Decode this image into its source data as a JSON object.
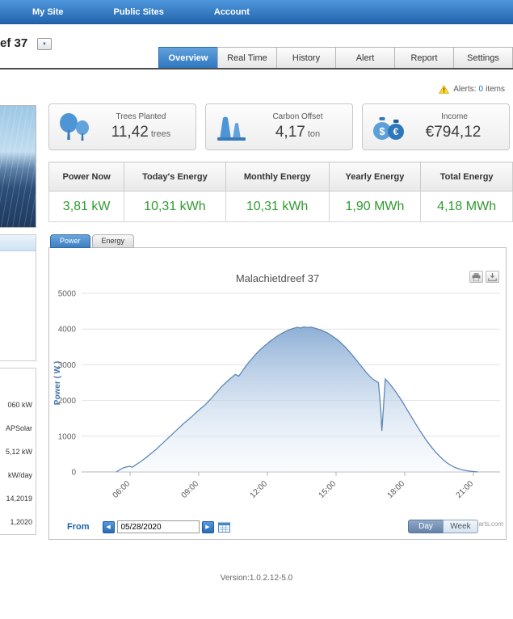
{
  "nav": {
    "items": [
      {
        "label": "My Site"
      },
      {
        "label": "Public Sites"
      },
      {
        "label": "Account"
      }
    ]
  },
  "header": {
    "site_title": "ef 37"
  },
  "tabs": [
    {
      "label": "Overview",
      "active": true
    },
    {
      "label": "Real Time"
    },
    {
      "label": "History"
    },
    {
      "label": "Alert"
    },
    {
      "label": "Report"
    },
    {
      "label": "Settings"
    }
  ],
  "alerts": {
    "label": "Alerts:",
    "count": "0",
    "suffix": "items"
  },
  "stats": [
    {
      "label": "Trees Planted",
      "value": "11,42",
      "unit": "trees"
    },
    {
      "label": "Carbon Offset",
      "value": "4,17",
      "unit": "ton"
    },
    {
      "label": "Income",
      "value": "€794,12",
      "unit": ""
    }
  ],
  "energy_table": {
    "headers": [
      "Power Now",
      "Today's Energy",
      "Monthly Energy",
      "Yearly Energy",
      "Total Energy"
    ],
    "values": [
      "3,81 kW",
      "10,31 kWh",
      "10,31 kWh",
      "1,90 MWh",
      "4,18 MWh"
    ]
  },
  "chart_tabs": [
    {
      "label": "Power",
      "active": true
    },
    {
      "label": "Energy",
      "active": false
    }
  ],
  "chart_data": {
    "type": "area",
    "title": "Malachietdreef 37",
    "xlabel": "",
    "ylabel": "Power ( W )",
    "ylim": [
      0,
      5000
    ],
    "yticks": [
      0,
      1000,
      2000,
      3000,
      4000,
      5000
    ],
    "xticks": [
      {
        "hour": 6,
        "label": "06:00"
      },
      {
        "hour": 9,
        "label": "09:00"
      },
      {
        "hour": 12,
        "label": "12:00"
      },
      {
        "hour": 15,
        "label": "15:00"
      },
      {
        "hour": 18,
        "label": "18:00"
      },
      {
        "hour": 21,
        "label": "21:00"
      }
    ],
    "grid": "horizontal",
    "legend_position": "none",
    "series": [
      {
        "name": "Power (W)",
        "points": [
          [
            5.4,
            0
          ],
          [
            5.55,
            60
          ],
          [
            5.7,
            110
          ],
          [
            5.85,
            140
          ],
          [
            6.0,
            155
          ],
          [
            6.1,
            130
          ],
          [
            6.25,
            200
          ],
          [
            6.4,
            260
          ],
          [
            6.55,
            330
          ],
          [
            6.7,
            400
          ],
          [
            6.85,
            480
          ],
          [
            7.0,
            560
          ],
          [
            7.15,
            640
          ],
          [
            7.3,
            730
          ],
          [
            7.45,
            820
          ],
          [
            7.6,
            910
          ],
          [
            7.75,
            1000
          ],
          [
            7.9,
            1090
          ],
          [
            8.05,
            1180
          ],
          [
            8.2,
            1270
          ],
          [
            8.35,
            1360
          ],
          [
            8.5,
            1440
          ],
          [
            8.65,
            1520
          ],
          [
            8.8,
            1610
          ],
          [
            8.95,
            1700
          ],
          [
            9.1,
            1780
          ],
          [
            9.25,
            1860
          ],
          [
            9.4,
            1960
          ],
          [
            9.55,
            2060
          ],
          [
            9.7,
            2170
          ],
          [
            9.85,
            2280
          ],
          [
            10.0,
            2390
          ],
          [
            10.15,
            2480
          ],
          [
            10.3,
            2570
          ],
          [
            10.45,
            2650
          ],
          [
            10.6,
            2730
          ],
          [
            10.75,
            2680
          ],
          [
            10.9,
            2820
          ],
          [
            11.05,
            2960
          ],
          [
            11.2,
            3080
          ],
          [
            11.35,
            3190
          ],
          [
            11.5,
            3300
          ],
          [
            11.65,
            3400
          ],
          [
            11.8,
            3490
          ],
          [
            11.95,
            3570
          ],
          [
            12.1,
            3650
          ],
          [
            12.25,
            3720
          ],
          [
            12.4,
            3790
          ],
          [
            12.55,
            3850
          ],
          [
            12.7,
            3900
          ],
          [
            12.85,
            3950
          ],
          [
            13.0,
            3990
          ],
          [
            13.15,
            4020
          ],
          [
            13.3,
            4050
          ],
          [
            13.45,
            4030
          ],
          [
            13.6,
            4060
          ],
          [
            13.75,
            4040
          ],
          [
            13.9,
            4055
          ],
          [
            14.05,
            4030
          ],
          [
            14.2,
            4000
          ],
          [
            14.35,
            3970
          ],
          [
            14.5,
            3930
          ],
          [
            14.65,
            3880
          ],
          [
            14.8,
            3820
          ],
          [
            14.95,
            3750
          ],
          [
            15.1,
            3680
          ],
          [
            15.25,
            3590
          ],
          [
            15.4,
            3500
          ],
          [
            15.55,
            3390
          ],
          [
            15.7,
            3280
          ],
          [
            15.85,
            3160
          ],
          [
            16.0,
            3040
          ],
          [
            16.15,
            2920
          ],
          [
            16.3,
            2800
          ],
          [
            16.45,
            2690
          ],
          [
            16.6,
            2600
          ],
          [
            16.75,
            2540
          ],
          [
            16.85,
            2500
          ],
          [
            16.95,
            1800
          ],
          [
            17.0,
            1150
          ],
          [
            17.08,
            1900
          ],
          [
            17.15,
            2600
          ],
          [
            17.3,
            2500
          ],
          [
            17.45,
            2380
          ],
          [
            17.6,
            2250
          ],
          [
            17.75,
            2110
          ],
          [
            17.9,
            1960
          ],
          [
            18.05,
            1800
          ],
          [
            18.2,
            1640
          ],
          [
            18.35,
            1480
          ],
          [
            18.5,
            1320
          ],
          [
            18.65,
            1170
          ],
          [
            18.8,
            1020
          ],
          [
            18.95,
            880
          ],
          [
            19.1,
            750
          ],
          [
            19.25,
            630
          ],
          [
            19.4,
            520
          ],
          [
            19.55,
            420
          ],
          [
            19.7,
            330
          ],
          [
            19.85,
            250
          ],
          [
            20.0,
            190
          ],
          [
            20.15,
            140
          ],
          [
            20.3,
            100
          ],
          [
            20.45,
            70
          ],
          [
            20.6,
            45
          ],
          [
            20.8,
            25
          ],
          [
            21.0,
            12
          ],
          [
            21.2,
            0
          ]
        ]
      }
    ]
  },
  "controls": {
    "from_label": "From",
    "date_value": "05/28/2020",
    "day_label": "Day",
    "week_label": "Week"
  },
  "watermark": "arts.com",
  "sidebar": {
    "fragments": [
      "060 kW",
      "APSolar",
      "5,12 kW",
      "kW/day",
      "14,2019",
      "1,2020"
    ]
  },
  "footer": {
    "version": "Version:1.0.2.12-5.0"
  },
  "icons": {
    "dropdown": "▼",
    "prev": "◀",
    "next": "▶",
    "dollar": "$",
    "euro": "€"
  },
  "colors": {
    "nav_blue": "#2e6db8",
    "active_tab_blue": "#3d7fc1",
    "value_green": "#2f9b2f",
    "area_fill": "#88abd4",
    "line": "#5e88b5",
    "axis_label": "#4572a7"
  }
}
